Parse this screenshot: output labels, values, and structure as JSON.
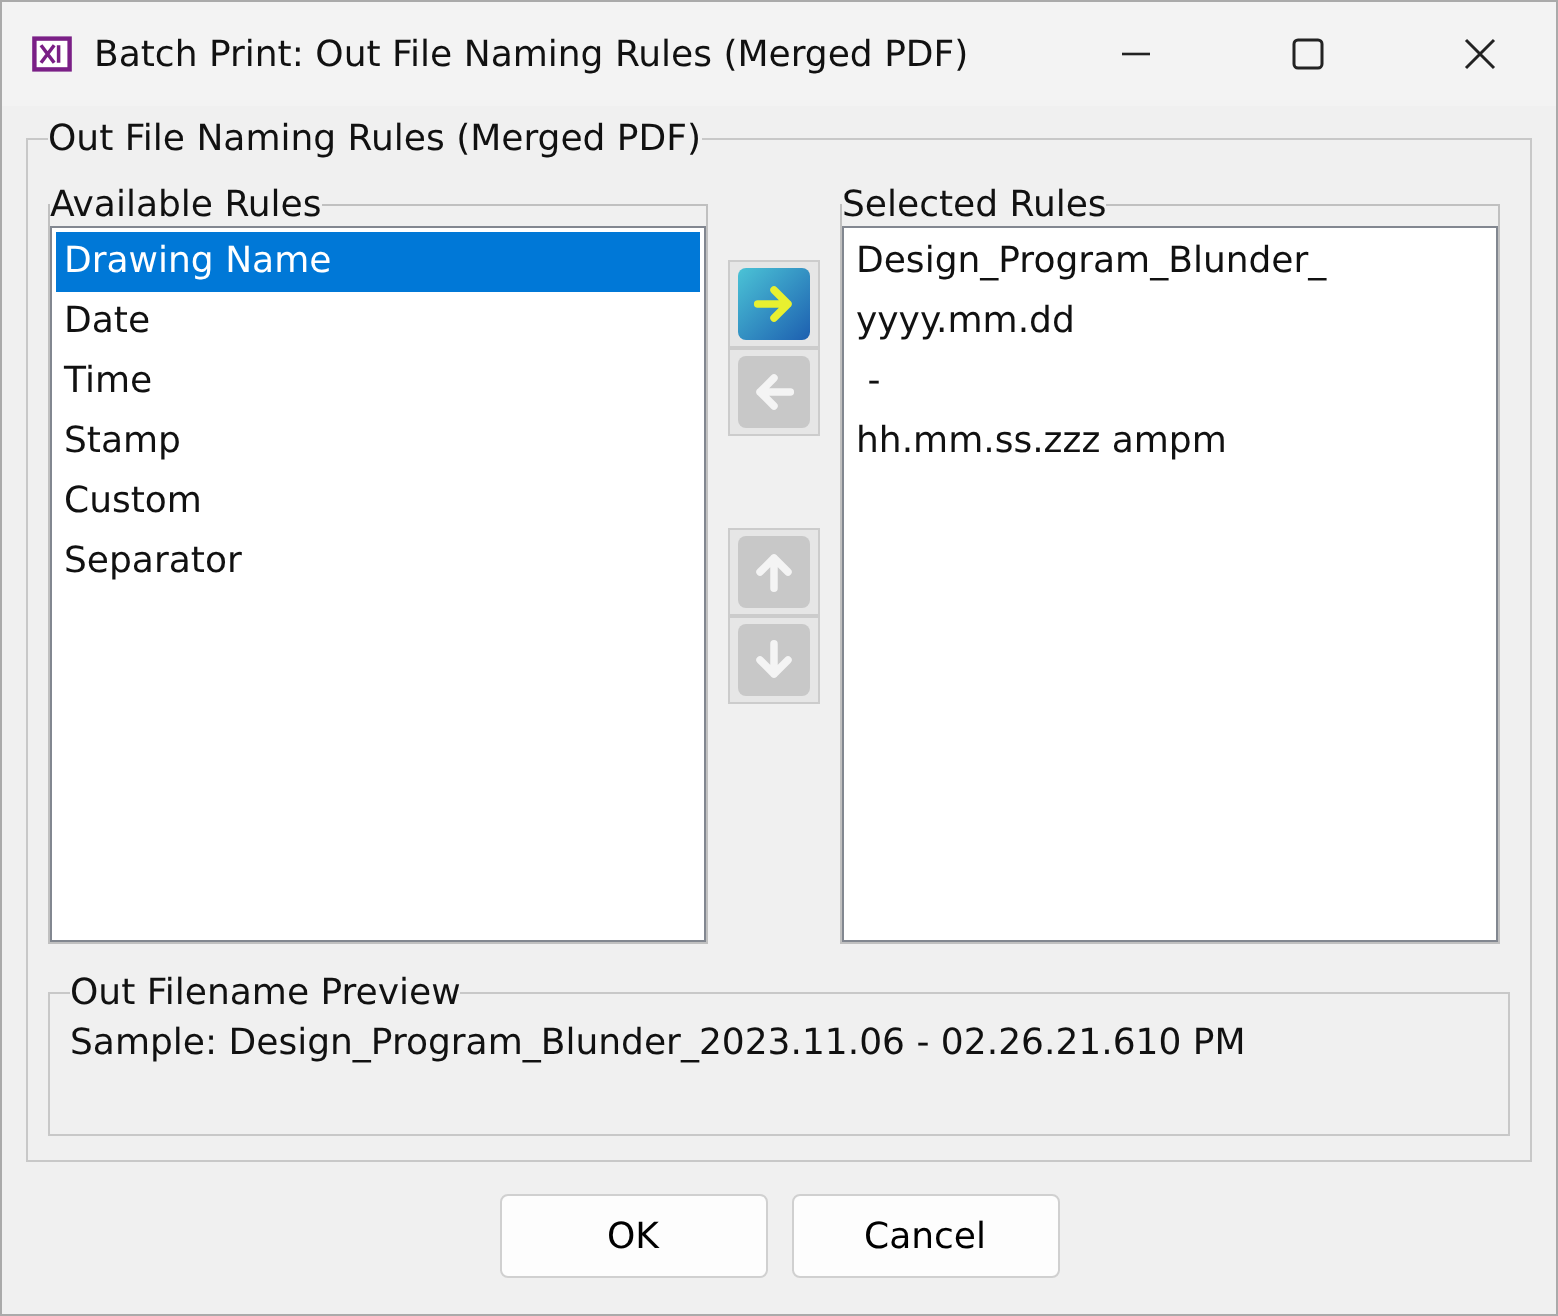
{
  "window": {
    "title": "Batch Print: Out File Naming Rules (Merged PDF)"
  },
  "group": {
    "title": "Out File Naming Rules (Merged PDF)"
  },
  "available": {
    "title": "Available Rules",
    "items": [
      {
        "label": "Drawing Name",
        "selected": true
      },
      {
        "label": "Date",
        "selected": false
      },
      {
        "label": "Time",
        "selected": false
      },
      {
        "label": "Stamp",
        "selected": false
      },
      {
        "label": "Custom",
        "selected": false
      },
      {
        "label": "Separator",
        "selected": false
      }
    ]
  },
  "arrow_buttons": [
    {
      "kind": "right",
      "disabled": false
    },
    {
      "kind": "left",
      "disabled": true
    },
    {
      "kind": "up",
      "disabled": true
    },
    {
      "kind": "down",
      "disabled": true
    }
  ],
  "selected_rules": {
    "title": "Selected Rules",
    "items": [
      {
        "label": "Design_Program_Blunder_"
      },
      {
        "label": "yyyy.mm.dd"
      },
      {
        "label": " -"
      },
      {
        "label": "hh.mm.ss.zzz ampm"
      }
    ]
  },
  "preview": {
    "title": "Out Filename Preview",
    "text": "Sample: Design_Program_Blunder_2023.11.06 - 02.26.21.610 PM"
  },
  "buttons": [
    "OK",
    "Cancel"
  ]
}
